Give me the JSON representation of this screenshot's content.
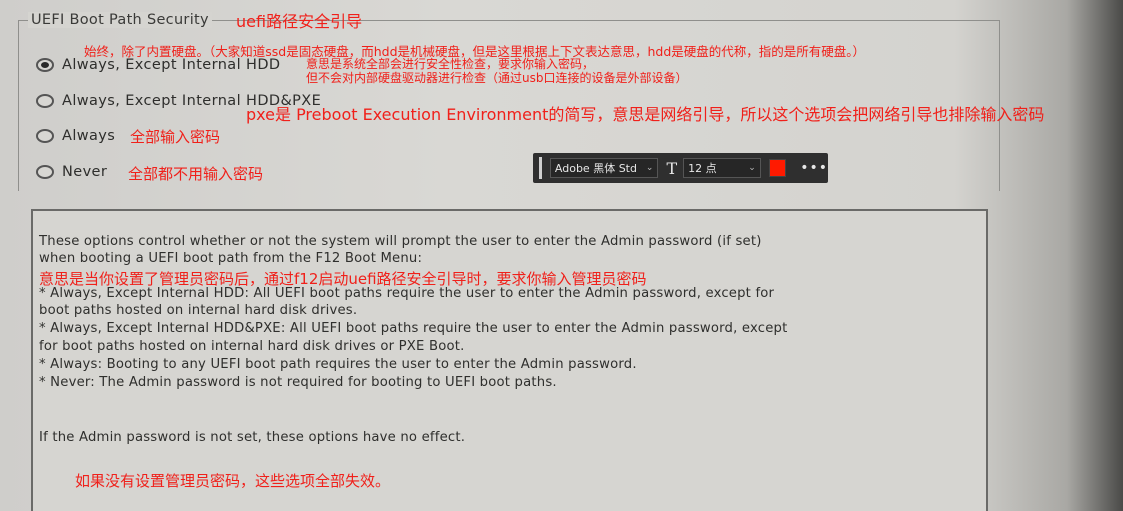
{
  "group": {
    "title": "UEFI Boot Path Security",
    "title_note": "uefi路径安全引导"
  },
  "notes": {
    "line1": "始终，除了内置硬盘。（大家知道ssd是固态硬盘，而hdd是机械硬盘，但是这里根据上下文表达意思，hdd是硬盘的代称，指的是所有硬盘。）",
    "line2": "意思是系统全部会进行安全性检查，要求你输入密码，",
    "line3": "但不会对内部硬盘驱动器进行检查（通过usb口连接的设备是外部设备）",
    "pxe": "pxe是 Preboot Execution Environment的简写，意思是网络引导，所以这个选项会把网络引导也排除输入密码",
    "always": "全部输入密码",
    "never": "全部都不用输入密码",
    "help": "意思是当你设置了管理员密码后，通过f12启动uefi路径安全引导时，要求你输入管理员密码",
    "bottom": "如果没有设置管理员密码，这些选项全部失效。"
  },
  "options": [
    {
      "label": "Always, Except Internal HDD",
      "checked": true
    },
    {
      "label": "Always, Except Internal HDD&PXE",
      "checked": false
    },
    {
      "label": "Always",
      "checked": false
    },
    {
      "label": "Never",
      "checked": false
    }
  ],
  "toolbar": {
    "font_family": "Adobe 黑体 Std",
    "font_size": "12 点",
    "color": "#ff1a00",
    "more": "•••"
  },
  "help": {
    "line1": "These options control whether or not the system will prompt the user to enter the Admin password (if set)",
    "line2": "when booting a UEFI boot path from the F12 Boot Menu:",
    "line3": "* Always, Except Internal HDD: All UEFI boot paths require the user to enter the Admin password, except for",
    "line4": "boot paths hosted on internal hard disk drives.",
    "line5": "* Always, Except Internal HDD&PXE: All UEFI boot paths require the user to enter the Admin password, except",
    "line6": "for boot paths hosted on internal hard disk drives or PXE Boot.",
    "line7": "* Always: Booting to any UEFI boot path requires the user to enter the Admin password.",
    "line8": "* Never:  The Admin password is not required for booting to UEFI boot paths.",
    "line9": "If the Admin password is not set, these options have no effect."
  }
}
